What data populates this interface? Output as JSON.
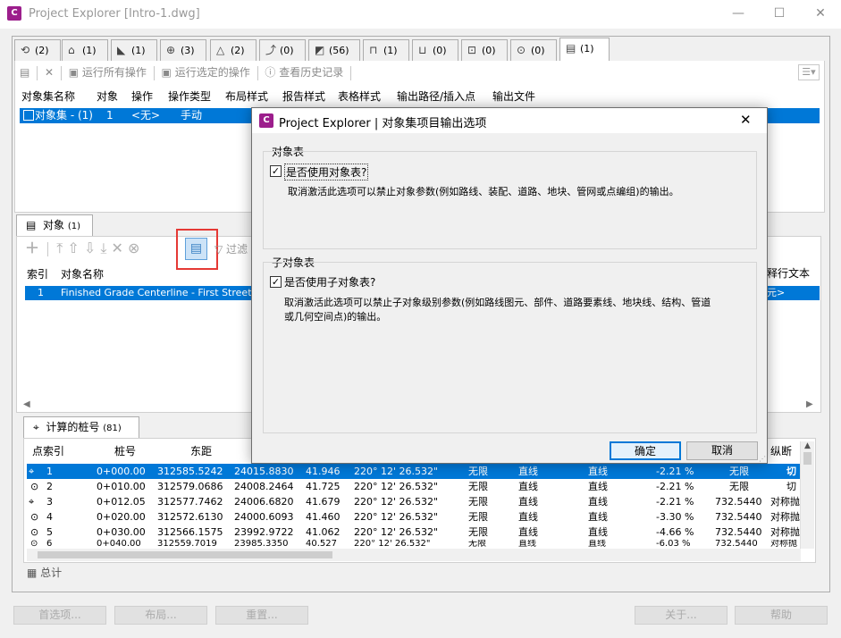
{
  "window": {
    "app_icon": "C",
    "title": "Project Explorer [Intro-1.dwg]",
    "minimize": "—",
    "maximize": "☐",
    "close": "✕"
  },
  "top_tabs": [
    {
      "icon": "alignment-icon",
      "glyph": "⟲",
      "label": "(2)"
    },
    {
      "icon": "profile-icon",
      "glyph": "⌂",
      "label": "(1)"
    },
    {
      "icon": "corridor-icon",
      "glyph": "◣",
      "label": "(1)"
    },
    {
      "icon": "assembly-icon",
      "glyph": "⊕",
      "label": "(3)"
    },
    {
      "icon": "surface-icon",
      "glyph": "△",
      "label": "(2)"
    },
    {
      "icon": "featureline-icon",
      "glyph": "⤴",
      "label": "(0)"
    },
    {
      "icon": "pipe-network-icon",
      "glyph": "◩",
      "label": "(56)"
    },
    {
      "icon": "structure-icon",
      "glyph": "⊓",
      "label": "(1)"
    },
    {
      "icon": "pressure-icon",
      "glyph": "⊔",
      "label": "(0)"
    },
    {
      "icon": "parcel-icon",
      "glyph": "⊡",
      "label": "(0)"
    },
    {
      "icon": "point-group-icon",
      "glyph": "⊙",
      "label": "(0)"
    },
    {
      "icon": "object-set-icon",
      "glyph": "▤",
      "label": "(1)"
    }
  ],
  "upper_toolbar": {
    "run_all": "运行所有操作",
    "run_selected": "运行选定的操作",
    "view_history": "查看历史记录"
  },
  "object_set_table": {
    "headers": [
      "对象集名称",
      "对象",
      "操作",
      "操作类型",
      "布局样式",
      "报告样式",
      "表格样式",
      "输出路径/插入点",
      "输出文件"
    ],
    "row": {
      "name": "对象集 - (1)",
      "objects": "1",
      "operation": "<无>",
      "op_type": "手动"
    }
  },
  "objects_tab": {
    "label": "对象",
    "count": "(1)"
  },
  "objects_toolbar": {
    "filter": "过滤"
  },
  "objects_table": {
    "headers": [
      "索引",
      "对象名称"
    ],
    "right_header": "释行文本",
    "row": {
      "index": "1",
      "name": "Finished Grade Centerline - First Street",
      "right": "元>"
    }
  },
  "stations_tab": {
    "label": "计算的桩号",
    "count": "(81)"
  },
  "stations_table": {
    "headers": [
      "点索引",
      "桩号",
      "东距",
      "",
      "",
      "",
      "",
      "",
      "",
      "",
      "",
      "纵断面"
    ],
    "rows": [
      [
        "1",
        "0+000.00",
        "312585.5242",
        "24015.8830",
        "41.946",
        "220° 12' 26.532\"",
        "无限",
        "直线",
        "直线",
        "-2.21 %",
        "无限",
        "切"
      ],
      [
        "2",
        "0+010.00",
        "312579.0686",
        "24008.2464",
        "41.725",
        "220° 12' 26.532\"",
        "无限",
        "直线",
        "直线",
        "-2.21 %",
        "无限",
        "切"
      ],
      [
        "3",
        "0+012.05",
        "312577.7462",
        "24006.6820",
        "41.679",
        "220° 12' 26.532\"",
        "无限",
        "直线",
        "直线",
        "-2.21 %",
        "732.5440",
        "对称抛"
      ],
      [
        "4",
        "0+020.00",
        "312572.6130",
        "24000.6093",
        "41.460",
        "220° 12' 26.532\"",
        "无限",
        "直线",
        "直线",
        "-3.30 %",
        "732.5440",
        "对称抛"
      ],
      [
        "5",
        "0+030.00",
        "312566.1575",
        "23992.9722",
        "41.062",
        "220° 12' 26.532\"",
        "无限",
        "直线",
        "直线",
        "-4.66 %",
        "732.5440",
        "对称抛"
      ],
      [
        "6",
        "0+040.00",
        "312559.7019",
        "23985.3350",
        "40.527",
        "220° 12' 26.532\"",
        "无限",
        "直线",
        "直线",
        "-6.03 %",
        "732.5440",
        "对称抛"
      ]
    ],
    "total_label": "总计"
  },
  "bottom_buttons": {
    "preferences": "首选项...",
    "layout": "布局...",
    "reset": "重置...",
    "about": "关于...",
    "help": "帮助"
  },
  "dialog": {
    "title": "Project Explorer | 对象集项目输出选项",
    "object_table_group": "对象表",
    "use_object_table": "是否使用对象表?",
    "object_table_desc": "取消激活此选项可以禁止对象参数(例如路线、装配、道路、地块、管网或点编组)的输出。",
    "sub_object_group": "子对象表",
    "use_sub_object_table": "是否使用子对象表?",
    "sub_object_desc_1": "取消激活此选项可以禁止子对象级别参数(例如路线图元、部件、道路要素线、地块线、结构、管道",
    "sub_object_desc_2": "或几何空间点)的输出。",
    "ok": "确定",
    "cancel": "取消",
    "close": "✕",
    "check": "✓"
  },
  "colors": {
    "selection": "#0078d7",
    "highlight_box": "#e53935"
  }
}
